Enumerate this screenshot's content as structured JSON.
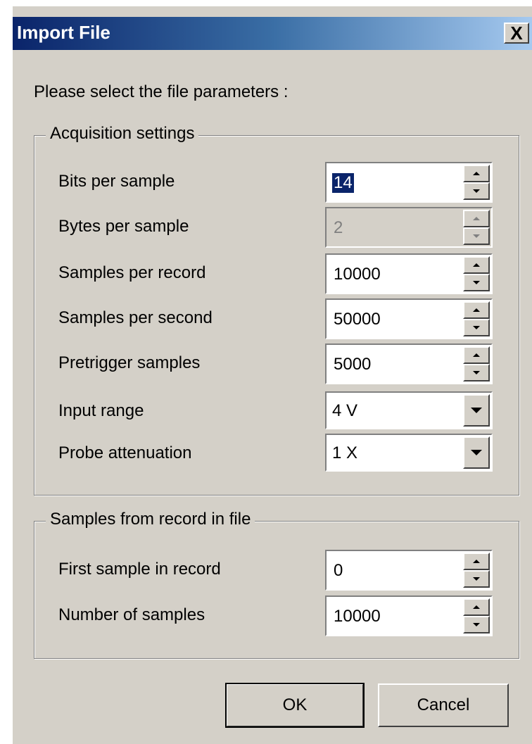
{
  "window": {
    "title": "Import File",
    "close_label": "X"
  },
  "prompt": "Please select the file parameters :",
  "acquisition": {
    "legend": "Acquisition settings",
    "fields": [
      {
        "label": "Bits per sample",
        "value": "14",
        "disabled": false,
        "type": "spin",
        "selected": true
      },
      {
        "label": "Bytes per sample",
        "value": "2",
        "disabled": true,
        "type": "spin",
        "selected": false
      },
      {
        "label": "Samples per record",
        "value": "10000",
        "disabled": false,
        "type": "spin",
        "selected": false
      },
      {
        "label": "Samples per second",
        "value": "50000",
        "disabled": false,
        "type": "spin",
        "selected": false
      },
      {
        "label": "Pretrigger samples",
        "value": "5000",
        "disabled": false,
        "type": "spin",
        "selected": false
      },
      {
        "label": "Input range",
        "value": "4 V",
        "disabled": false,
        "type": "combo",
        "selected": false
      },
      {
        "label": "Probe attenuation",
        "value": "1 X",
        "disabled": false,
        "type": "combo",
        "selected": false
      }
    ]
  },
  "samples": {
    "legend": "Samples from record in file",
    "fields": [
      {
        "label": "First sample in record",
        "value": "0",
        "disabled": false,
        "type": "spin",
        "selected": false
      },
      {
        "label": "Number of samples",
        "value": "10000",
        "disabled": false,
        "type": "spin",
        "selected": false
      }
    ]
  },
  "buttons": {
    "ok": "OK",
    "cancel": "Cancel"
  },
  "colors": {
    "face": "#d4d0c8",
    "title_start": "#0a246a",
    "title_end": "#a6caf0",
    "selection": "#0a246a"
  }
}
